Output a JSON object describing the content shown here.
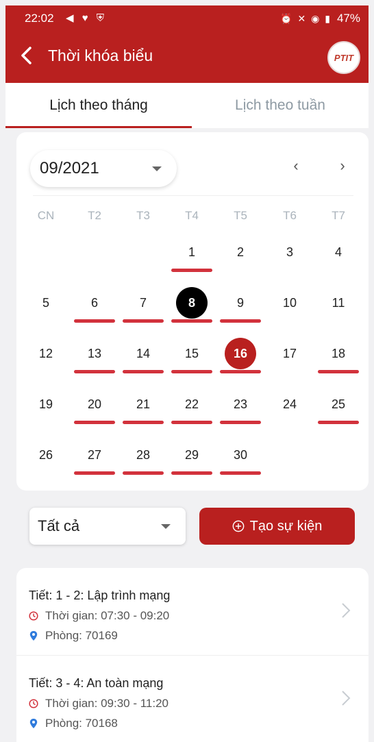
{
  "status": {
    "time": "22:02",
    "left_icons": "◀ ♥ ⛨",
    "right_icons": "⏰ ✕ ◉ ▮",
    "battery": "47%"
  },
  "header": {
    "title": "Thời khóa biểu",
    "logo_text": "PTIT"
  },
  "tabs": [
    {
      "label": "Lịch theo tháng",
      "active": true
    },
    {
      "label": "Lịch theo tuần",
      "active": false
    }
  ],
  "calendar": {
    "month_label": "09/2021",
    "prev_label": "‹",
    "next_label": "›",
    "weekdays": [
      "CN",
      "T2",
      "T3",
      "T4",
      "T5",
      "T6",
      "T7"
    ],
    "rows": [
      [
        "",
        "",
        "",
        "1",
        "2",
        "3",
        "4"
      ],
      [
        "5",
        "6",
        "7",
        "8",
        "9",
        "10",
        "11"
      ],
      [
        "12",
        "13",
        "14",
        "15",
        "16",
        "17",
        "18"
      ],
      [
        "19",
        "20",
        "21",
        "22",
        "23",
        "24",
        "25"
      ],
      [
        "26",
        "27",
        "28",
        "29",
        "30",
        "",
        ""
      ]
    ],
    "today": "8",
    "selected": "16",
    "event_days": [
      "1",
      "6",
      "7",
      "8",
      "9",
      "13",
      "14",
      "15",
      "16",
      "18",
      "20",
      "21",
      "22",
      "23",
      "25",
      "27",
      "28",
      "29",
      "30"
    ]
  },
  "filter": {
    "label": "Tất cả"
  },
  "create_button": {
    "label": "Tạo sự kiện"
  },
  "events": [
    {
      "title": "Tiết: 1 - 2: Lập trình mạng",
      "time": "Thời gian: 07:30 - 09:20",
      "room": "Phòng: 70169"
    },
    {
      "title": "Tiết: 3 - 4: An toàn mạng",
      "time": "Thời gian: 09:30 - 11:20",
      "room": "Phòng: 70168"
    }
  ],
  "colors": {
    "brand_red": "#b9201f",
    "event_bar": "#d2323c",
    "today_bg": "#000000"
  }
}
